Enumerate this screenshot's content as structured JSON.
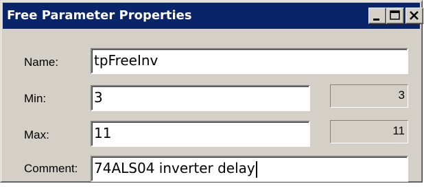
{
  "window": {
    "title": "Free Parameter Properties",
    "title_bar_color": "#0a246a",
    "controls": {
      "minimize_icon": "minimize-icon",
      "maximize_icon": "maximize-icon",
      "close_icon": "close-icon"
    }
  },
  "form": {
    "name": {
      "label": "Name:",
      "value": "tpFreeInv"
    },
    "min": {
      "label": "Min:",
      "value": "3",
      "readout": "3"
    },
    "max": {
      "label": "Max:",
      "value": "11",
      "readout": "11"
    },
    "comment": {
      "label": "Comment:",
      "value": "74ALS04 inverter delay"
    }
  }
}
